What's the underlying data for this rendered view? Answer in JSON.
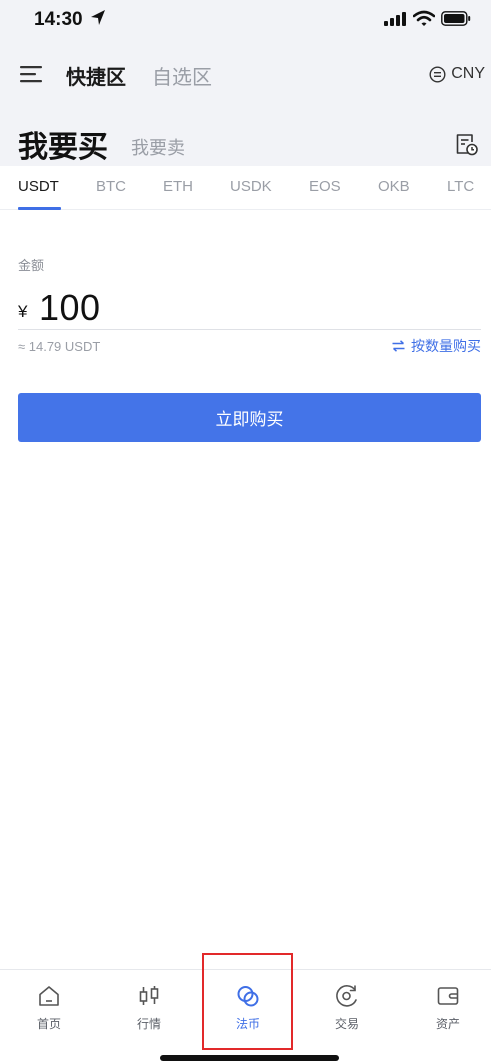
{
  "status_bar": {
    "time": "14:30"
  },
  "header": {
    "tabs": [
      "快捷区",
      "自选区"
    ],
    "currency": "CNY"
  },
  "trade_mode": {
    "buy": "我要买",
    "sell": "我要卖"
  },
  "coins": [
    "USDT",
    "BTC",
    "ETH",
    "USDK",
    "EOS",
    "OKB",
    "LTC"
  ],
  "selected_coin": "USDT",
  "amount": {
    "label": "金额",
    "currency_symbol": "¥",
    "value": "100",
    "approx": "≈ 14.79 USDT",
    "switch_label": "按数量购买"
  },
  "buy_button": "立即购买",
  "bottom_nav": [
    {
      "label": "首页",
      "icon": "home-icon"
    },
    {
      "label": "行情",
      "icon": "candlestick-icon"
    },
    {
      "label": "法币",
      "icon": "fiat-icon",
      "active": true
    },
    {
      "label": "交易",
      "icon": "trade-icon"
    },
    {
      "label": "资产",
      "icon": "wallet-icon"
    }
  ],
  "colors": {
    "accent": "#4474e8",
    "top_background": "#f2f3f7",
    "highlight": "#e2292a"
  }
}
